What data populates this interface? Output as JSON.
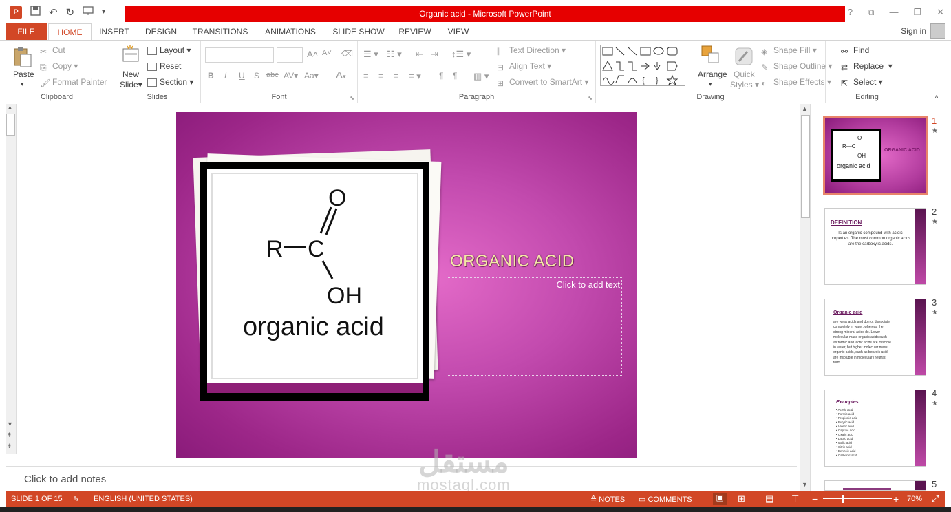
{
  "window": {
    "title": "Organic acid -  Microsoft PowerPoint",
    "logo_text": "P",
    "controls": [
      "?",
      "⧉",
      "—",
      "❐",
      "✕"
    ]
  },
  "qat": {
    "icons": [
      "save-icon",
      "undo-icon",
      "redo-icon",
      "presentation-icon",
      "customize-icon"
    ]
  },
  "tabs": [
    "FILE",
    "HOME",
    "INSERT",
    "DESIGN",
    "TRANSITIONS",
    "ANIMATIONS",
    "SLIDE SHOW",
    "REVIEW",
    "VIEW"
  ],
  "active_tab": "HOME",
  "signin": "Sign in",
  "ribbon": {
    "clipboard": {
      "label": "Clipboard",
      "paste": "Paste",
      "cut": "Cut",
      "copy": "Copy",
      "format_painter": "Format Painter"
    },
    "slides": {
      "label": "Slides",
      "new_slide_1": "New",
      "new_slide_2": "Slide",
      "layout": "Layout",
      "reset": "Reset",
      "section": "Section"
    },
    "font": {
      "label": "Font",
      "bold": "B",
      "italic": "I",
      "underline": "U",
      "shadow": "S",
      "strike": "abc",
      "spacing": "AV",
      "case": "Aa",
      "color": "A"
    },
    "paragraph": {
      "label": "Paragraph",
      "text_direction": "Text Direction",
      "align_text": "Align Text",
      "convert_smartart": "Convert to SmartArt"
    },
    "drawing": {
      "label": "Drawing",
      "arrange": "Arrange",
      "quick_styles_1": "Quick",
      "quick_styles_2": "Styles",
      "shape_fill": "Shape Fill",
      "shape_outline": "Shape Outline",
      "shape_effects": "Shape Effects"
    },
    "editing": {
      "label": "Editing",
      "find": "Find",
      "replace": "Replace",
      "select": "Select"
    }
  },
  "slide": {
    "image_text": {
      "r": "R",
      "c": "C",
      "o": "O",
      "oh": "OH",
      "caption": "organic acid"
    },
    "title": "ORGANIC ACID",
    "placeholder": "Click to add text"
  },
  "notes_placeholder": "Click to add notes",
  "watermark": {
    "arabic": "مستقل",
    "latin": "mostaql.com"
  },
  "thumbnails": [
    {
      "num": "1",
      "caption": "organic acid",
      "title": "ORGANIC ACID"
    },
    {
      "num": "2",
      "heading": "DEFINITION",
      "body": "Is an organic compound with acidic properties. The most common organic acids are the carboxylic acids."
    },
    {
      "num": "3",
      "heading": "Organic acid",
      "body": "are weak acids and do not dissociate completely in water, whereas the strong mineral acids do. Lower molecular mass organic acids such as formic and lactic acids are miscible in water, but higher molecular mass organic acids, such as benzoic acid, are insoluble in molecular (neutral) form."
    },
    {
      "num": "4",
      "heading": "Examples",
      "items": [
        "Acetic acid",
        "Formic acid",
        "Propionic acid",
        "Butyric acid",
        "Valeric acid",
        "Caproic acid",
        "Oxalic acid",
        "Lactic acid",
        "Malic acid",
        "Citric acid",
        "Benzoic acid",
        "Carbonic acid"
      ]
    },
    {
      "num": "5"
    }
  ],
  "status": {
    "slide": "SLIDE 1 OF 15",
    "language": "ENGLISH (UNITED STATES)",
    "notes": "NOTES",
    "comments": "COMMENTS",
    "zoom": "70%"
  },
  "colors": {
    "accent": "#d24726",
    "title_bar": "#e60000",
    "slide_bg": "#c24aae"
  }
}
